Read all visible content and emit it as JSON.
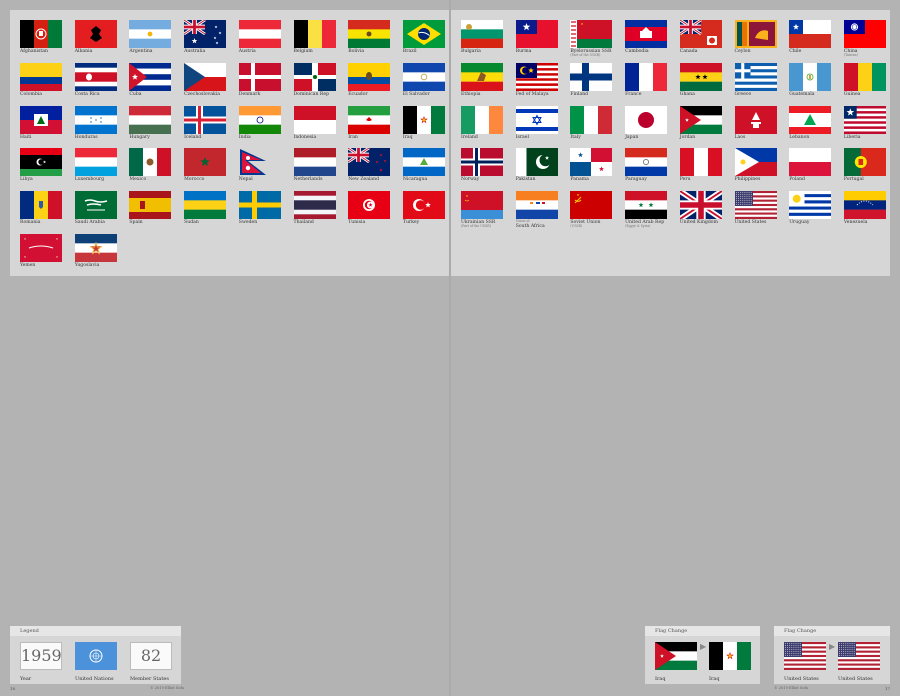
{
  "page": {
    "left_page_number": "18",
    "right_page_number": "17",
    "copyright_left": "© 2019 Elliot Sofa",
    "copyright_right": "© 2019 Elliot Sofa"
  },
  "left_flags": [
    {
      "name": "Afghanistan",
      "flag": "afghanistan"
    },
    {
      "name": "Albania",
      "flag": "albania"
    },
    {
      "name": "Argentina",
      "flag": "argentina"
    },
    {
      "name": "Australia",
      "flag": "australia"
    },
    {
      "name": "Austria",
      "flag": "austria"
    },
    {
      "name": "Belgium",
      "flag": "belgium"
    },
    {
      "name": "Bolivia",
      "flag": "bolivia"
    },
    {
      "name": "Brazil",
      "flag": "brazil"
    },
    {
      "name": "Colombia",
      "flag": "colombia"
    },
    {
      "name": "Costa Rica",
      "flag": "costarica"
    },
    {
      "name": "Cuba",
      "flag": "cuba"
    },
    {
      "name": "Czechoslovakia",
      "flag": "czechoslovakia"
    },
    {
      "name": "Denmark",
      "flag": "denmark"
    },
    {
      "name": "Dominican Rep",
      "flag": "dominican"
    },
    {
      "name": "Ecuador",
      "flag": "ecuador"
    },
    {
      "name": "El Salvador",
      "flag": "elsalvador"
    },
    {
      "name": "Haiti",
      "flag": "haiti"
    },
    {
      "name": "Honduras",
      "flag": "honduras"
    },
    {
      "name": "Hungary",
      "flag": "hungary"
    },
    {
      "name": "Iceland",
      "flag": "iceland"
    },
    {
      "name": "India",
      "flag": "india"
    },
    {
      "name": "Indonesia",
      "flag": "indonesia"
    },
    {
      "name": "Iran",
      "flag": "iran"
    },
    {
      "name": "Iraq",
      "flag": "iraq"
    },
    {
      "name": "Libya",
      "flag": "libya"
    },
    {
      "name": "Luxembourg",
      "flag": "luxembourg"
    },
    {
      "name": "Mexico",
      "flag": "mexico"
    },
    {
      "name": "Morocco",
      "flag": "morocco"
    },
    {
      "name": "Nepal",
      "flag": "nepal"
    },
    {
      "name": "Netherlands",
      "flag": "netherlands"
    },
    {
      "name": "New Zealand",
      "flag": "newzealand"
    },
    {
      "name": "Nicaragua",
      "flag": "nicaragua"
    },
    {
      "name": "Romania",
      "flag": "romania"
    },
    {
      "name": "Saudi Arabia",
      "flag": "saudi"
    },
    {
      "name": "Spain",
      "flag": "spain"
    },
    {
      "name": "Sudan",
      "flag": "sudan"
    },
    {
      "name": "Sweden",
      "flag": "sweden"
    },
    {
      "name": "Thailand",
      "flag": "thailand"
    },
    {
      "name": "Tunisia",
      "flag": "tunisia"
    },
    {
      "name": "Turkey",
      "flag": "turkey"
    },
    {
      "name": "Yemen",
      "flag": "yemen"
    },
    {
      "name": "Yugoslavia",
      "flag": "yugoslavia"
    }
  ],
  "right_flags": [
    {
      "name": "Bulgaria",
      "flag": "bulgaria"
    },
    {
      "name": "Burma",
      "flag": "burma"
    },
    {
      "name": "Byelorussian SSR",
      "sub": "(Part of the USSR)",
      "flag": "byelorussia"
    },
    {
      "name": "Cambodia",
      "flag": "cambodia"
    },
    {
      "name": "Canada",
      "flag": "canada"
    },
    {
      "name": "Ceylon",
      "flag": "ceylon"
    },
    {
      "name": "Chile",
      "flag": "chile"
    },
    {
      "name": "China",
      "sub": "(Taiwan)",
      "flag": "china"
    },
    {
      "name": "Ethiopia",
      "flag": "ethiopia"
    },
    {
      "name": "Fed of Malaya",
      "flag": "malaya"
    },
    {
      "name": "Finland",
      "flag": "finland"
    },
    {
      "name": "France",
      "flag": "france"
    },
    {
      "name": "Ghana",
      "flag": "ghana"
    },
    {
      "name": "Greece",
      "flag": "greece"
    },
    {
      "name": "Guatemala",
      "flag": "guatemala"
    },
    {
      "name": "Guinea",
      "flag": "guinea"
    },
    {
      "name": "Ireland",
      "flag": "ireland"
    },
    {
      "name": "Israel",
      "flag": "israel"
    },
    {
      "name": "Italy",
      "flag": "italy"
    },
    {
      "name": "Japan",
      "flag": "japan"
    },
    {
      "name": "Jordan",
      "flag": "jordan"
    },
    {
      "name": "Laos",
      "flag": "laos"
    },
    {
      "name": "Lebanon",
      "flag": "lebanon"
    },
    {
      "name": "Liberia",
      "flag": "liberia"
    },
    {
      "name": "Norway",
      "flag": "norway"
    },
    {
      "name": "Pakistan",
      "flag": "pakistan"
    },
    {
      "name": "Panama",
      "flag": "panama"
    },
    {
      "name": "Paraguay",
      "flag": "paraguay"
    },
    {
      "name": "Peru",
      "flag": "peru"
    },
    {
      "name": "Philippines",
      "flag": "philippines"
    },
    {
      "name": "Poland",
      "flag": "poland"
    },
    {
      "name": "Portugal",
      "flag": "portugal"
    },
    {
      "name": "Ukrainian SSR",
      "sub": "(Part of the USSR)",
      "flag": "ukraine"
    },
    {
      "name": "South Africa",
      "pre": "Union of",
      "flag": "southafrica"
    },
    {
      "name": "Soviet Union",
      "sub": "(USSR)",
      "flag": "ussr"
    },
    {
      "name": "United Arab Rep",
      "sub": "(Egypt & Syria)",
      "flag": "uar"
    },
    {
      "name": "United Kingdom",
      "flag": "uk"
    },
    {
      "name": "United States",
      "flag": "us"
    },
    {
      "name": "Uruguay",
      "flag": "uruguay"
    },
    {
      "name": "Venezuela",
      "flag": "venezuela"
    }
  ],
  "legend": {
    "title": "Legend",
    "year_value": "1959",
    "year_label": "Year",
    "un_label": "United Nations",
    "member_value": "82",
    "member_label": "Member States"
  },
  "flag_change_iraq": {
    "title": "Flag Change",
    "from_label": "Iraq",
    "to_label": "Iraq"
  },
  "flag_change_us": {
    "title": "Flag Change",
    "from_label": "United States",
    "to_label": "United States"
  }
}
